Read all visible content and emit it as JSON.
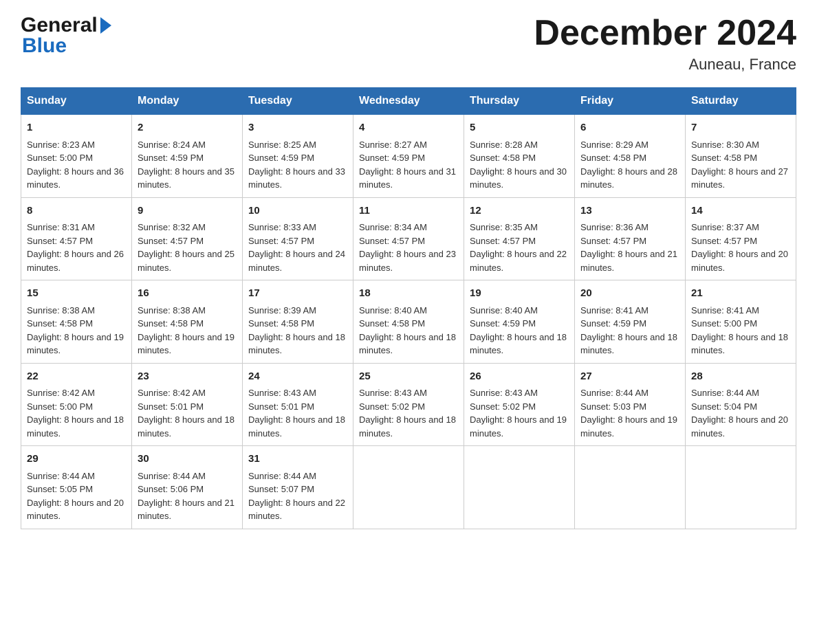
{
  "header": {
    "month_title": "December 2024",
    "location": "Auneau, France"
  },
  "logo": {
    "general": "General",
    "blue": "Blue"
  },
  "days_of_week": [
    "Sunday",
    "Monday",
    "Tuesday",
    "Wednesday",
    "Thursday",
    "Friday",
    "Saturday"
  ],
  "weeks": [
    [
      {
        "day": "1",
        "sunrise": "8:23 AM",
        "sunset": "5:00 PM",
        "daylight": "8 hours and 36 minutes."
      },
      {
        "day": "2",
        "sunrise": "8:24 AM",
        "sunset": "4:59 PM",
        "daylight": "8 hours and 35 minutes."
      },
      {
        "day": "3",
        "sunrise": "8:25 AM",
        "sunset": "4:59 PM",
        "daylight": "8 hours and 33 minutes."
      },
      {
        "day": "4",
        "sunrise": "8:27 AM",
        "sunset": "4:59 PM",
        "daylight": "8 hours and 31 minutes."
      },
      {
        "day": "5",
        "sunrise": "8:28 AM",
        "sunset": "4:58 PM",
        "daylight": "8 hours and 30 minutes."
      },
      {
        "day": "6",
        "sunrise": "8:29 AM",
        "sunset": "4:58 PM",
        "daylight": "8 hours and 28 minutes."
      },
      {
        "day": "7",
        "sunrise": "8:30 AM",
        "sunset": "4:58 PM",
        "daylight": "8 hours and 27 minutes."
      }
    ],
    [
      {
        "day": "8",
        "sunrise": "8:31 AM",
        "sunset": "4:57 PM",
        "daylight": "8 hours and 26 minutes."
      },
      {
        "day": "9",
        "sunrise": "8:32 AM",
        "sunset": "4:57 PM",
        "daylight": "8 hours and 25 minutes."
      },
      {
        "day": "10",
        "sunrise": "8:33 AM",
        "sunset": "4:57 PM",
        "daylight": "8 hours and 24 minutes."
      },
      {
        "day": "11",
        "sunrise": "8:34 AM",
        "sunset": "4:57 PM",
        "daylight": "8 hours and 23 minutes."
      },
      {
        "day": "12",
        "sunrise": "8:35 AM",
        "sunset": "4:57 PM",
        "daylight": "8 hours and 22 minutes."
      },
      {
        "day": "13",
        "sunrise": "8:36 AM",
        "sunset": "4:57 PM",
        "daylight": "8 hours and 21 minutes."
      },
      {
        "day": "14",
        "sunrise": "8:37 AM",
        "sunset": "4:57 PM",
        "daylight": "8 hours and 20 minutes."
      }
    ],
    [
      {
        "day": "15",
        "sunrise": "8:38 AM",
        "sunset": "4:58 PM",
        "daylight": "8 hours and 19 minutes."
      },
      {
        "day": "16",
        "sunrise": "8:38 AM",
        "sunset": "4:58 PM",
        "daylight": "8 hours and 19 minutes."
      },
      {
        "day": "17",
        "sunrise": "8:39 AM",
        "sunset": "4:58 PM",
        "daylight": "8 hours and 18 minutes."
      },
      {
        "day": "18",
        "sunrise": "8:40 AM",
        "sunset": "4:58 PM",
        "daylight": "8 hours and 18 minutes."
      },
      {
        "day": "19",
        "sunrise": "8:40 AM",
        "sunset": "4:59 PM",
        "daylight": "8 hours and 18 minutes."
      },
      {
        "day": "20",
        "sunrise": "8:41 AM",
        "sunset": "4:59 PM",
        "daylight": "8 hours and 18 minutes."
      },
      {
        "day": "21",
        "sunrise": "8:41 AM",
        "sunset": "5:00 PM",
        "daylight": "8 hours and 18 minutes."
      }
    ],
    [
      {
        "day": "22",
        "sunrise": "8:42 AM",
        "sunset": "5:00 PM",
        "daylight": "8 hours and 18 minutes."
      },
      {
        "day": "23",
        "sunrise": "8:42 AM",
        "sunset": "5:01 PM",
        "daylight": "8 hours and 18 minutes."
      },
      {
        "day": "24",
        "sunrise": "8:43 AM",
        "sunset": "5:01 PM",
        "daylight": "8 hours and 18 minutes."
      },
      {
        "day": "25",
        "sunrise": "8:43 AM",
        "sunset": "5:02 PM",
        "daylight": "8 hours and 18 minutes."
      },
      {
        "day": "26",
        "sunrise": "8:43 AM",
        "sunset": "5:02 PM",
        "daylight": "8 hours and 19 minutes."
      },
      {
        "day": "27",
        "sunrise": "8:44 AM",
        "sunset": "5:03 PM",
        "daylight": "8 hours and 19 minutes."
      },
      {
        "day": "28",
        "sunrise": "8:44 AM",
        "sunset": "5:04 PM",
        "daylight": "8 hours and 20 minutes."
      }
    ],
    [
      {
        "day": "29",
        "sunrise": "8:44 AM",
        "sunset": "5:05 PM",
        "daylight": "8 hours and 20 minutes."
      },
      {
        "day": "30",
        "sunrise": "8:44 AM",
        "sunset": "5:06 PM",
        "daylight": "8 hours and 21 minutes."
      },
      {
        "day": "31",
        "sunrise": "8:44 AM",
        "sunset": "5:07 PM",
        "daylight": "8 hours and 22 minutes."
      },
      null,
      null,
      null,
      null
    ]
  ]
}
